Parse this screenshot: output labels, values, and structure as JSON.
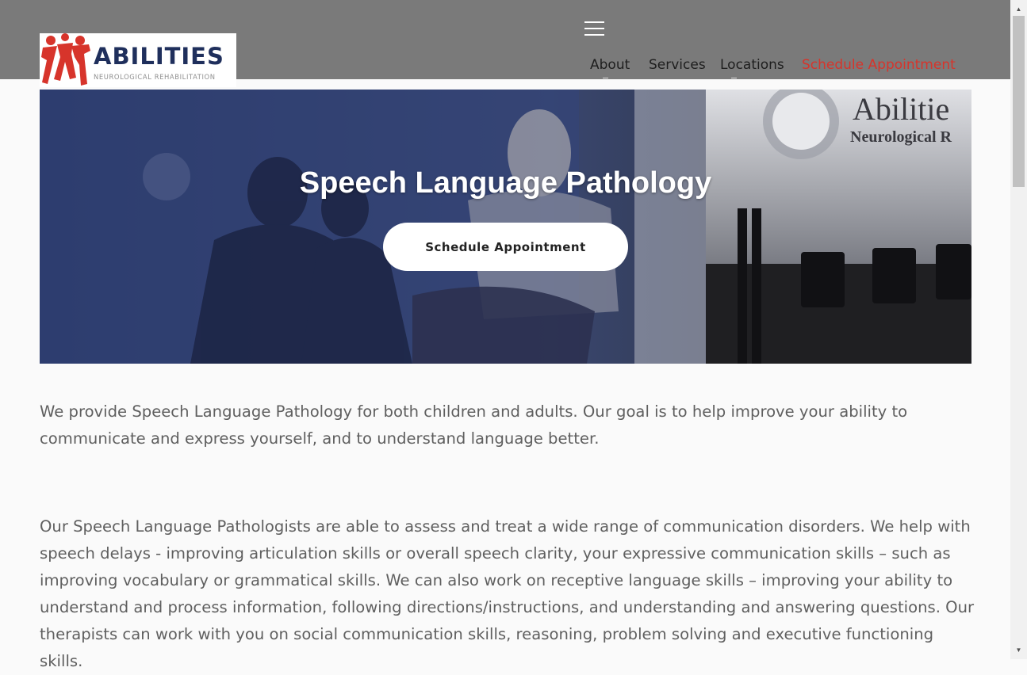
{
  "logo": {
    "word": "ABILITIES",
    "sub": "NEUROLOGICAL REHABILITATION"
  },
  "nav": {
    "about": "About",
    "services": "Services",
    "locations": "Locations",
    "schedule": "Schedule Appointment"
  },
  "hero": {
    "title": "Speech Language Pathology",
    "button": "Schedule Appointment",
    "sign_word": "Abilitie",
    "sign_sub": "Neurological R"
  },
  "content": {
    "p1": "We provide Speech Language Pathology for both children and adults.  Our goal is to help improve your ability to communicate and express yourself, and to understand language better.",
    "p2": "Our Speech Language Pathologists are able to assess and treat a wide range of communication disorders.  We help with speech delays - improving articulation skills or overall speech clarity, your expressive communication skills – such as improving vocabulary or grammatical skills. We can also work on receptive language skills – improving your ability to understand and process information, following directions/instructions, and understanding and answering questions.  Our therapists can work with you on social communication skills, reasoning, problem solving and executive functioning skills."
  },
  "colors": {
    "header": "#7a7a7a",
    "accent": "#d7342b",
    "brand_navy": "#1f2f5c",
    "hero_tint": "#2b3a6b"
  },
  "icons": {
    "menu": "hamburger-icon",
    "scroll_up": "arrow-up-icon",
    "scroll_down": "arrow-down-icon"
  }
}
